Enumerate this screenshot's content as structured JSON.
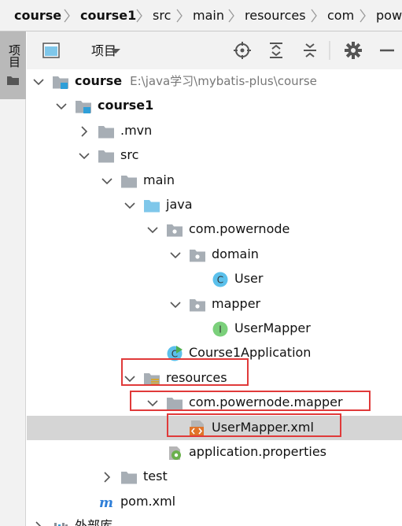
{
  "breadcrumb": [
    "course",
    "course1",
    "src",
    "main",
    "resources",
    "com",
    "pow"
  ],
  "sidebar_tab": {
    "label": "项目",
    "icon": "folder-icon"
  },
  "toolbar": {
    "view_label": "项目",
    "icons": [
      "project-view-icon",
      "dropdown-arrow-icon",
      "locate-icon",
      "expand-all-icon",
      "collapse-all-icon",
      "gear-icon",
      "hide-icon"
    ]
  },
  "tree": [
    {
      "label": "course",
      "path": "E:\\java学习\\mybatis-plus\\course",
      "icon": "module-folder-icon",
      "expanded": true
    },
    {
      "label": "course1",
      "icon": "module-folder-icon",
      "expanded": true
    },
    {
      "label": ".mvn",
      "icon": "folder-icon",
      "expanded": false
    },
    {
      "label": "src",
      "icon": "folder-icon",
      "expanded": true
    },
    {
      "label": "main",
      "icon": "folder-icon",
      "expanded": true
    },
    {
      "label": "java",
      "icon": "source-folder-icon",
      "expanded": true
    },
    {
      "label": "com.powernode",
      "icon": "package-icon",
      "expanded": true
    },
    {
      "label": "domain",
      "icon": "package-icon",
      "expanded": true
    },
    {
      "label": "User",
      "icon": "class-icon"
    },
    {
      "label": "mapper",
      "icon": "package-icon",
      "expanded": true
    },
    {
      "label": "UserMapper",
      "icon": "interface-icon"
    },
    {
      "label": "Course1Application",
      "icon": "spring-class-icon"
    },
    {
      "label": "resources",
      "icon": "resources-folder-icon",
      "expanded": true
    },
    {
      "label": "com.powernode.mapper",
      "icon": "folder-icon",
      "expanded": true
    },
    {
      "label": "UserMapper.xml",
      "icon": "xml-file-icon",
      "selected": true
    },
    {
      "label": "application.properties",
      "icon": "properties-file-icon"
    },
    {
      "label": "test",
      "icon": "folder-icon",
      "expanded": false
    },
    {
      "label": "pom.xml",
      "icon": "maven-file-icon"
    },
    {
      "label": "外部库",
      "icon": "libraries-icon",
      "expanded": false
    }
  ],
  "colors": {
    "highlight_box": "#e03a3a",
    "selection": "#d5d5d5",
    "folder": "#a7aeb5",
    "source_folder": "#7fc7ea",
    "class_icon": "#5bc0eb",
    "interface_icon": "#7bd07b"
  }
}
